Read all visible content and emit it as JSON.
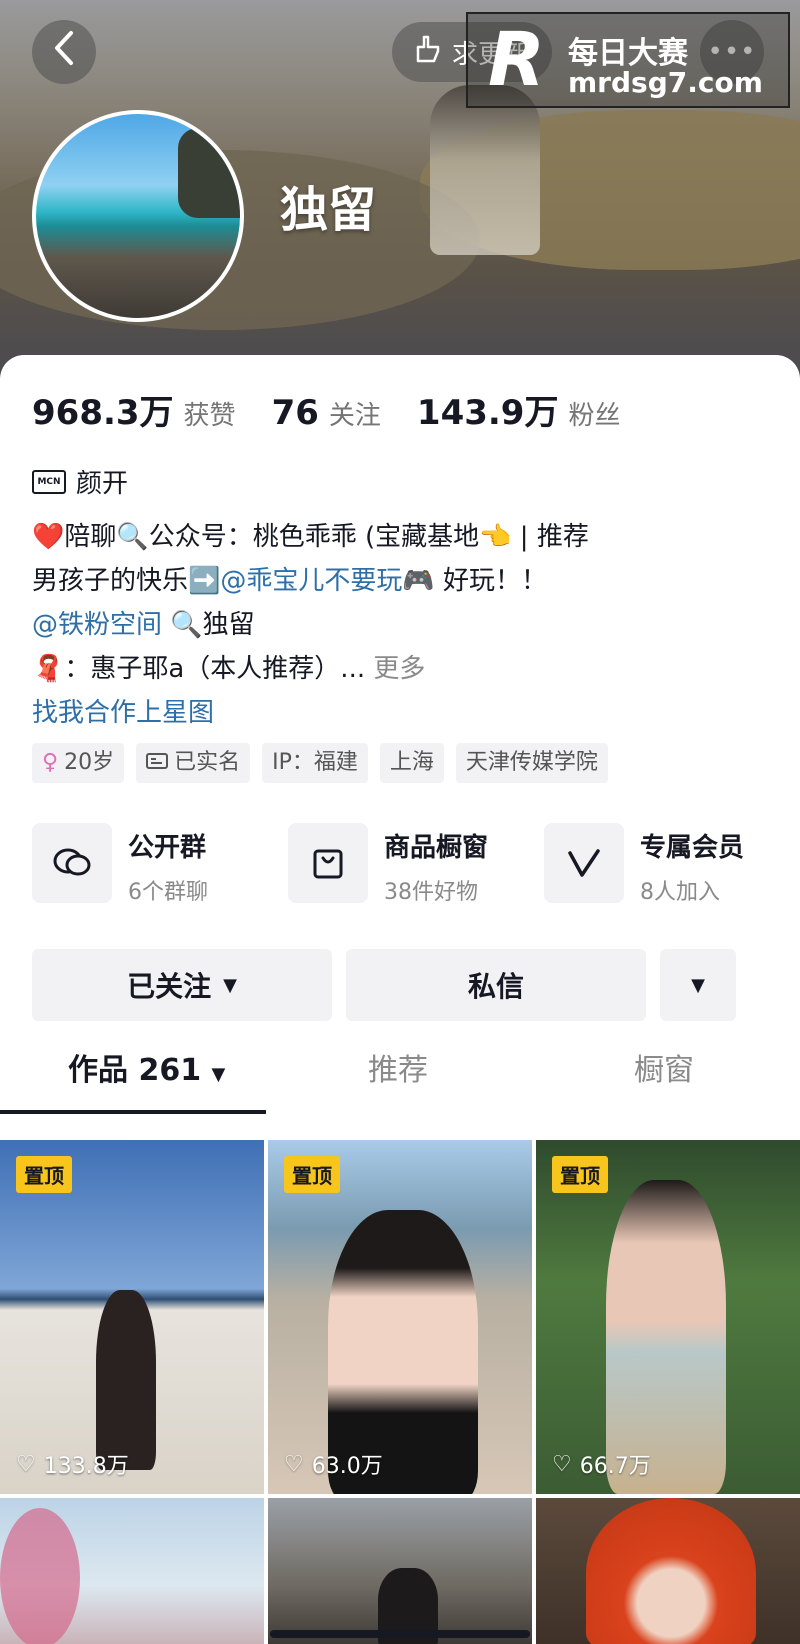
{
  "header": {
    "back_icon": "chevron-left-icon",
    "pill_label": "求更新",
    "more_icon": "ellipsis-icon",
    "username": "独留"
  },
  "watermark": {
    "logo": "R",
    "line1": "每日大赛",
    "line2": "mrdsg7.com"
  },
  "stats": [
    {
      "value": "968.3万",
      "label": "获赞"
    },
    {
      "value": "76",
      "label": "关注"
    },
    {
      "value": "143.9万",
      "label": "粉丝"
    }
  ],
  "mcn": {
    "badge": "MCN",
    "name": "颜开"
  },
  "bio": {
    "line1": "❤️陪聊🔍公众号：桃色乖乖 (宝藏基地👈 | 推荐",
    "line2_prefix": "男孩子的快乐➡️",
    "line2_mention": "@乖宝儿不要玩",
    "line2_suffix": "🎮 好玩！！",
    "line3_mention": "@铁粉空间",
    "line3_suffix": " 🔍独留",
    "line4": "🧣：惠子耶a（本人推荐）...",
    "more": "更多",
    "line5": "找我合作上星图"
  },
  "tags": [
    {
      "icon": "female-icon",
      "label": "20岁"
    },
    {
      "icon": "id-card-icon",
      "label": "已实名"
    },
    {
      "icon": "",
      "label": "IP：福建"
    },
    {
      "icon": "",
      "label": "上海"
    },
    {
      "icon": "",
      "label": "天津传媒学院"
    }
  ],
  "features": [
    {
      "icon": "group-chat-icon",
      "title": "公开群",
      "sub": "6个群聊"
    },
    {
      "icon": "shopping-bag-icon",
      "title": "商品橱窗",
      "sub": "38件好物"
    },
    {
      "icon": "member-v-icon",
      "title": "专属会员",
      "sub": "8人加入"
    }
  ],
  "actions": {
    "followed": "已关注",
    "message": "私信",
    "dropdown_icon": "triangle-down-icon"
  },
  "tabs": [
    {
      "label": "作品 261"
    },
    {
      "label": "推荐"
    },
    {
      "label": "橱窗"
    }
  ],
  "posts": [
    {
      "pinned": "置顶",
      "likes": "133.8万"
    },
    {
      "pinned": "置顶",
      "likes": "63.0万"
    },
    {
      "pinned": "置顶",
      "likes": "66.7万"
    }
  ],
  "colors": {
    "accent_link": "#2f6fa8",
    "pin_yellow": "#f8c51c",
    "text": "#161823",
    "muted": "#8a8a8a"
  }
}
